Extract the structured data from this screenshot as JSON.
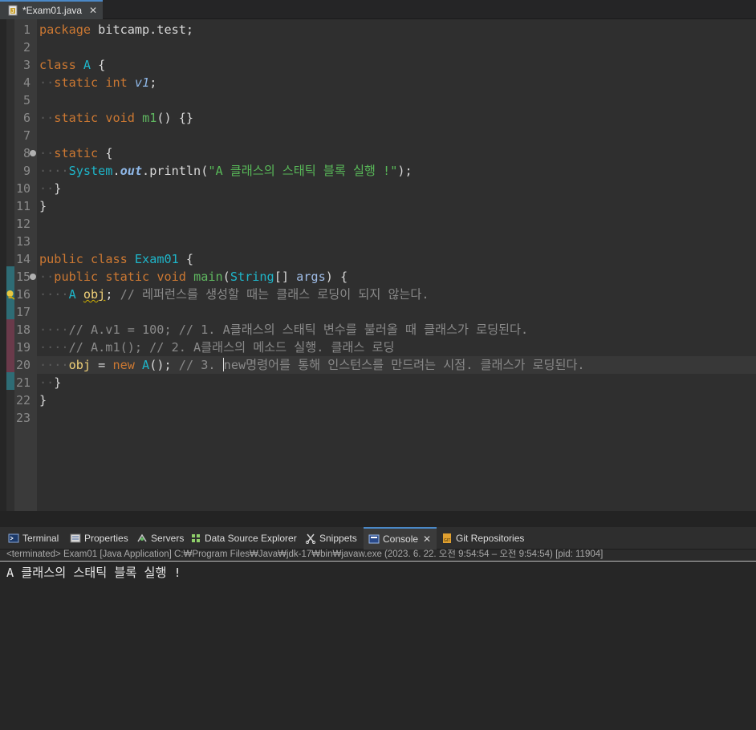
{
  "editor_tab": {
    "title": "*Exam01.java",
    "close": "✕",
    "icon": "java-file-icon"
  },
  "gutter": {
    "line_numbers": [
      "1",
      "2",
      "3",
      "4",
      "5",
      "6",
      "7",
      "8",
      "9",
      "10",
      "11",
      "12",
      "13",
      "14",
      "15",
      "16",
      "17",
      "18",
      "19",
      "20",
      "21",
      "22",
      "23"
    ]
  },
  "code": {
    "l1_kw": "package",
    "l1_rest": " bitcamp.test;",
    "l3_kw": "class",
    "l3_cls": "A",
    "l3_rest": " {",
    "l4_kw1": "static",
    "l4_kw2": "int",
    "l4_fld": "v1",
    "l4_rest": ";",
    "l6_kw1": "static",
    "l6_kw2": "void",
    "l6_mth": "m1",
    "l6_rest": "() {}",
    "l8_kw": "static",
    "l8_rest": " {",
    "l9_cls": "System",
    "l9_fld": "out",
    "l9_mid": ".println(",
    "l9_str": "\"A 클래스의 스태틱 블록 실행 !\"",
    "l9_end": ");",
    "l10": "}",
    "l11": "}",
    "l14_kw1": "public",
    "l14_kw2": "class",
    "l14_cls": "Exam01",
    "l14_rest": " {",
    "l15_kw1": "public",
    "l15_kw2": "static",
    "l15_kw3": "void",
    "l15_mth": "main",
    "l15_p1": "(",
    "l15_cls": "String",
    "l15_p2": "[] ",
    "l15_prm": "args",
    "l15_p3": ") {",
    "l16_cls": "A",
    "l16_var": "obj",
    "l16_semi": ";",
    "l16_cmt": "// 레퍼런스를 생성할 때는 클래스 로딩이 되지 않는다.",
    "l18_cmt": "// A.v1 = 100; // 1. A클래스의 스태틱 변수를 불러올 때 클래스가 로딩된다.",
    "l19_cmt": "// A.m1(); // 2. A클래스의 메소드 실행. 클래스 로딩",
    "l20_var": "obj",
    "l20_eq": " = ",
    "l20_kw": "new",
    "l20_cls": "A",
    "l20_p": "();",
    "l20_cmt1": "// 3. ",
    "l20_cmt2": "new명령어를 통해 인스턴스를 만드려는 시점. 클래스가 로딩된다.",
    "l21": "}",
    "l22": "}"
  },
  "panel": {
    "tabs": [
      {
        "label": "Terminal",
        "icon": "terminal-icon"
      },
      {
        "label": "Properties",
        "icon": "properties-icon"
      },
      {
        "label": "Servers",
        "icon": "servers-icon"
      },
      {
        "label": "Data Source Explorer",
        "icon": "data-source-icon"
      },
      {
        "label": "Snippets",
        "icon": "snippets-icon"
      },
      {
        "label": "Console",
        "icon": "console-icon"
      },
      {
        "label": "Git Repositories",
        "icon": "git-icon"
      }
    ],
    "active_tab": "Console",
    "close": "✕",
    "status": "<terminated> Exam01 [Java Application] C:₩Program Files₩Java₩jdk-17₩bin₩javaw.exe  (2023. 6. 22. 오전 9:54:54 – 오전 9:54:54) [pid: 11904]",
    "output": "A 클래스의 스태틱 블록 실행 !"
  },
  "colors": {
    "keyword": "#cc7832",
    "class": "#1eb5c9",
    "string": "#58b858",
    "comment": "#8a8a8a",
    "accent": "#4a88c7"
  }
}
